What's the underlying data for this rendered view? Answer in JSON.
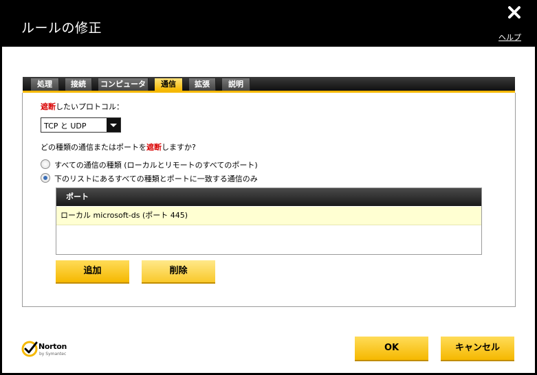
{
  "window": {
    "title": "ルールの修正",
    "help": "ヘルプ"
  },
  "tabs": [
    {
      "label": "処理"
    },
    {
      "label": "接続"
    },
    {
      "label": "コンピュータ"
    },
    {
      "label": "通信",
      "active": true
    },
    {
      "label": "拡張"
    },
    {
      "label": "説明"
    }
  ],
  "protocol": {
    "label_red": "遮断",
    "label_rest": "したいプロトコル：",
    "selected": "TCP と UDP"
  },
  "question": {
    "part1": "どの種類の通信またはポートを",
    "red": "遮断",
    "part2": "しますか?"
  },
  "radios": [
    {
      "label": "すべての通信の種類 (ローカルとリモートのすべてのポート)",
      "checked": false
    },
    {
      "label": "下のリストにあるすべての種類とポートに一致する通信のみ",
      "checked": true
    }
  ],
  "port_list": {
    "header": "ポート",
    "rows": [
      "ローカル microsoft-ds (ポート 445)"
    ]
  },
  "buttons": {
    "add": "追加",
    "delete": "削除",
    "ok": "OK",
    "cancel": "キャンセル"
  },
  "logo": {
    "name": "Norton",
    "sub": "by Symantec"
  },
  "colors": {
    "accent": "#f5b800",
    "warning_red": "#d90000",
    "selected_row": "#ffffd2"
  }
}
